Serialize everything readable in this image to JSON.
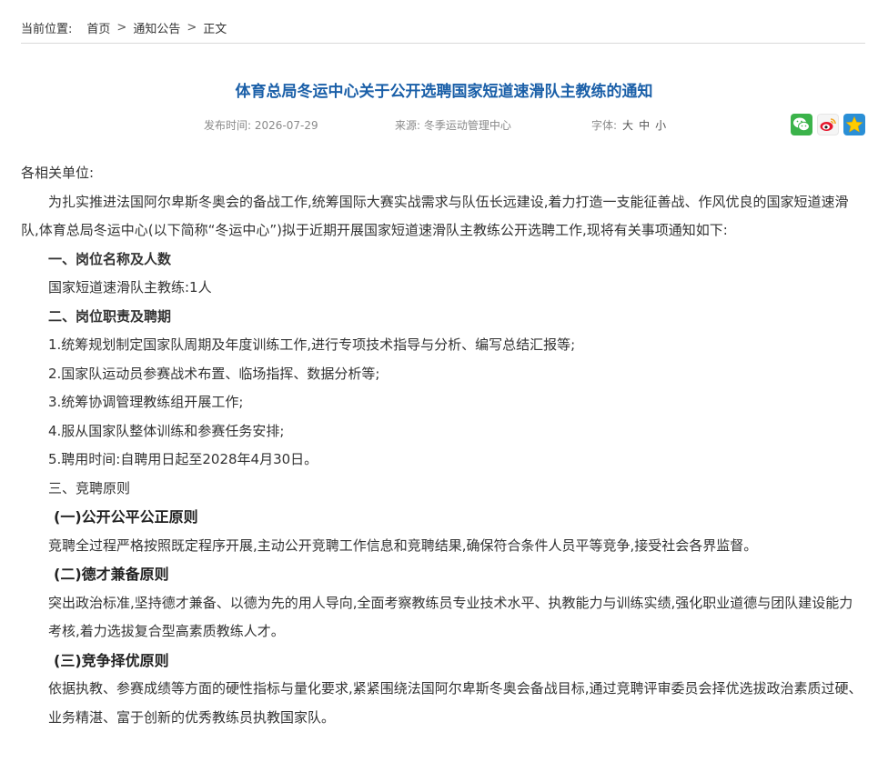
{
  "breadcrumb": {
    "prefix": "当前位置:",
    "items": [
      "首页",
      "通知公告",
      "正文"
    ],
    "separator": ">"
  },
  "article": {
    "title": "体育总局冬运中心关于公开选聘国家短道速滑队主教练的通知",
    "date_label": "发布时间: 2026-07-29",
    "source_label": "来源: 冬季运动管理中心",
    "font_label": "字体:",
    "font_sizes": [
      "大",
      "中",
      "小"
    ]
  },
  "share": {
    "icons": [
      "wechat-icon",
      "weibo-icon",
      "favorite-star-icon"
    ],
    "colors": {
      "wechat": "#3bb34a",
      "weibo": "#e6162d",
      "favorite": "#2a8fd6",
      "star": "#ffcc00"
    }
  },
  "body": {
    "salutation": "各相关单位:",
    "intro": "为扎实推进法国阿尔卑斯冬奥会的备战工作,统筹国际大赛实战需求与队伍长远建设,着力打造一支能征善战、作风优良的国家短道速滑队,体育总局冬运中心(以下简称“冬运中心”)拟于近期开展国家短道速滑队主教练公开选聘工作,现将有关事项通知如下:",
    "section1_title": "一、岗位名称及人数",
    "section1_item": "国家短道速滑队主教练:1人",
    "section2_title": "二、岗位职责及聘期",
    "duties": [
      "1.统筹规划制定国家队周期及年度训练工作,进行专项技术指导与分析、编写总结汇报等;",
      "2.国家队运动员参赛战术布置、临场指挥、数据分析等;",
      "3.统筹协调管理教练组开展工作;",
      "4.服从国家队整体训练和参赛任务安排;",
      "5.聘用时间:自聘用日起至2028年4月30日。"
    ],
    "section3_title": "三、竞聘原则",
    "principles": [
      {
        "title": "(一)公开公平公正原则",
        "text": "竞聘全过程严格按照既定程序开展,主动公开竞聘工作信息和竞聘结果,确保符合条件人员平等竞争,接受社会各界监督。"
      },
      {
        "title": "(二)德才兼备原则",
        "text": "突出政治标准,坚持德才兼备、以德为先的用人导向,全面考察教练员专业技术水平、执教能力与训练实绩,强化职业道德与团队建设能力考核,着力选拔复合型高素质教练人才。"
      },
      {
        "title": "(三)竞争择优原则",
        "text": "依据执教、参赛成绩等方面的硬性指标与量化要求,紧紧围绕法国阿尔卑斯冬奥会备战目标,通过竞聘评审委员会择优选拔政治素质过硬、业务精湛、富于创新的优秀教练员执教国家队。"
      }
    ]
  }
}
